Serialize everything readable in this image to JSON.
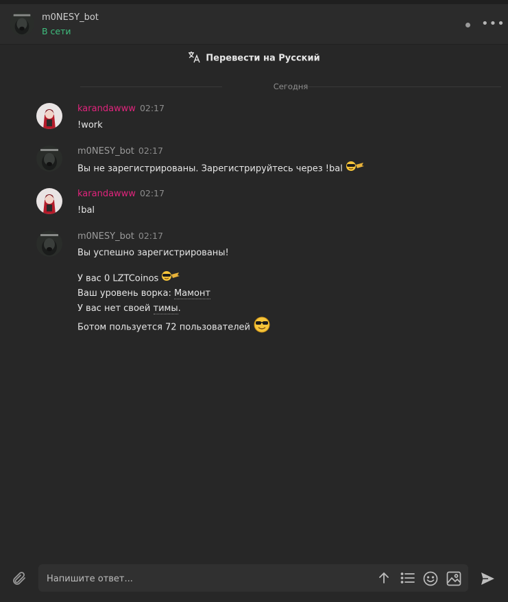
{
  "header": {
    "bot_name": "m0NESY_bot",
    "status": "В сети"
  },
  "translate": {
    "label": "Перевести на Русский",
    "icon": "translate-icon"
  },
  "date_separator": "Сегодня",
  "messages": [
    {
      "author": "karandawww",
      "time": "02:17",
      "lines": [
        "!work"
      ]
    },
    {
      "author": "m0NESY_bot",
      "time": "02:17",
      "lines": [
        "Вы не зарегистрированы. Зарегистрируйтесь через !bal"
      ]
    },
    {
      "author": "karandawww",
      "time": "02:17",
      "lines": [
        "!bal"
      ]
    },
    {
      "author": "m0NESY_bot",
      "time": "02:17",
      "lines": [
        "Вы успешно зарегистрированы!",
        "У вас 0 LZTCoinos",
        "Ваш уровень ворка: ",
        "Мамонт",
        "У вас нет своей ",
        "тимы",
        ".",
        "Ботом пользуется 72 пользователей"
      ]
    }
  ],
  "composer": {
    "placeholder": "Напишите ответ...",
    "icons": [
      "attach-icon",
      "arrow-up-icon",
      "list-icon",
      "smiley-icon",
      "image-icon",
      "send-icon"
    ]
  },
  "colors": {
    "background": "#272727",
    "user_name": "#e0247c",
    "bot_name": "#9c9c9c",
    "online": "#3fbf7f"
  }
}
